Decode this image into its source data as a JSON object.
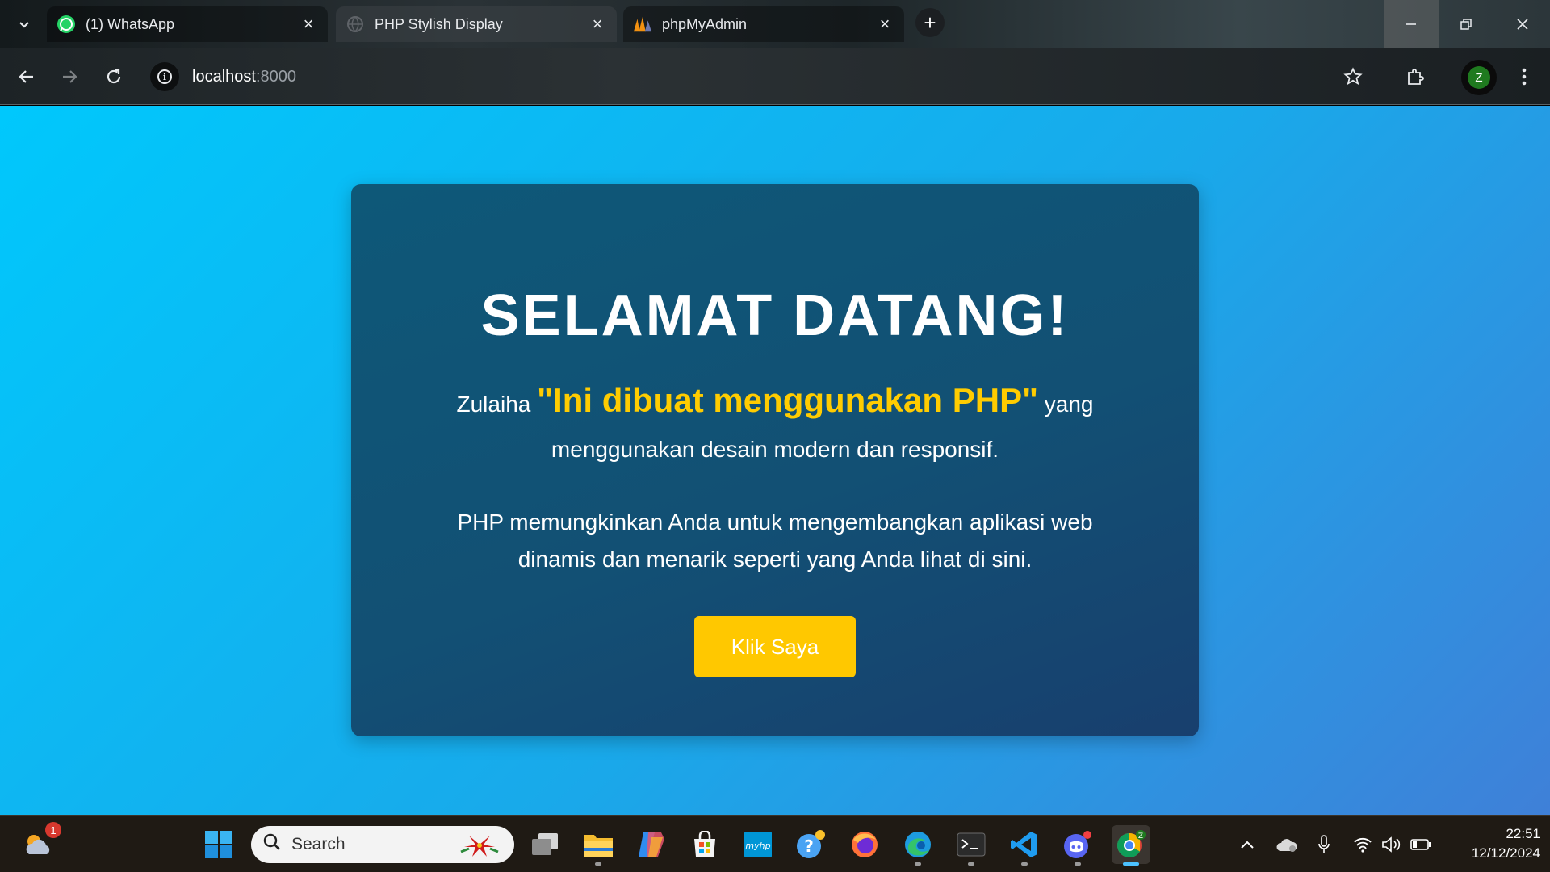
{
  "browser": {
    "tabs": [
      {
        "title": "(1) WhatsApp",
        "favicon": "whatsapp-icon",
        "active": false
      },
      {
        "title": "PHP Stylish Display",
        "favicon": "globe-icon",
        "active": true
      },
      {
        "title": "phpMyAdmin",
        "favicon": "phpmyadmin-icon",
        "active": false
      }
    ],
    "url_host": "localhost",
    "url_port": ":8000",
    "profile_initial": "Z"
  },
  "page": {
    "heading": "SELAMAT DATANG!",
    "lead_name": "Zulaiha",
    "lead_highlight": "\"Ini dibuat menggunakan PHP\"",
    "lead_rest": "yang menggunakan desain modern dan responsif.",
    "paragraph": "PHP memungkinkan Anda untuk mengembangkan aplikasi web dinamis dan menarik seperti yang Anda lihat di sini.",
    "button_label": "Klik Saya",
    "highlight_color": "#ffcc00",
    "button_color": "#ffc800"
  },
  "taskbar": {
    "search_placeholder": "Search",
    "weather_badge": "1",
    "apps": [
      "start-icon",
      "task-view-icon",
      "file-explorer-icon",
      "copilot-icon",
      "microsoft-store-icon",
      "myhp-icon",
      "get-help-icon",
      "firefox-icon",
      "edge-icon",
      "terminal-icon",
      "vscode-icon",
      "discord-icon",
      "chrome-icon"
    ],
    "myhp_label": "myhp",
    "chrome_badge": "Z",
    "time": "22:51",
    "date": "12/12/2024"
  }
}
